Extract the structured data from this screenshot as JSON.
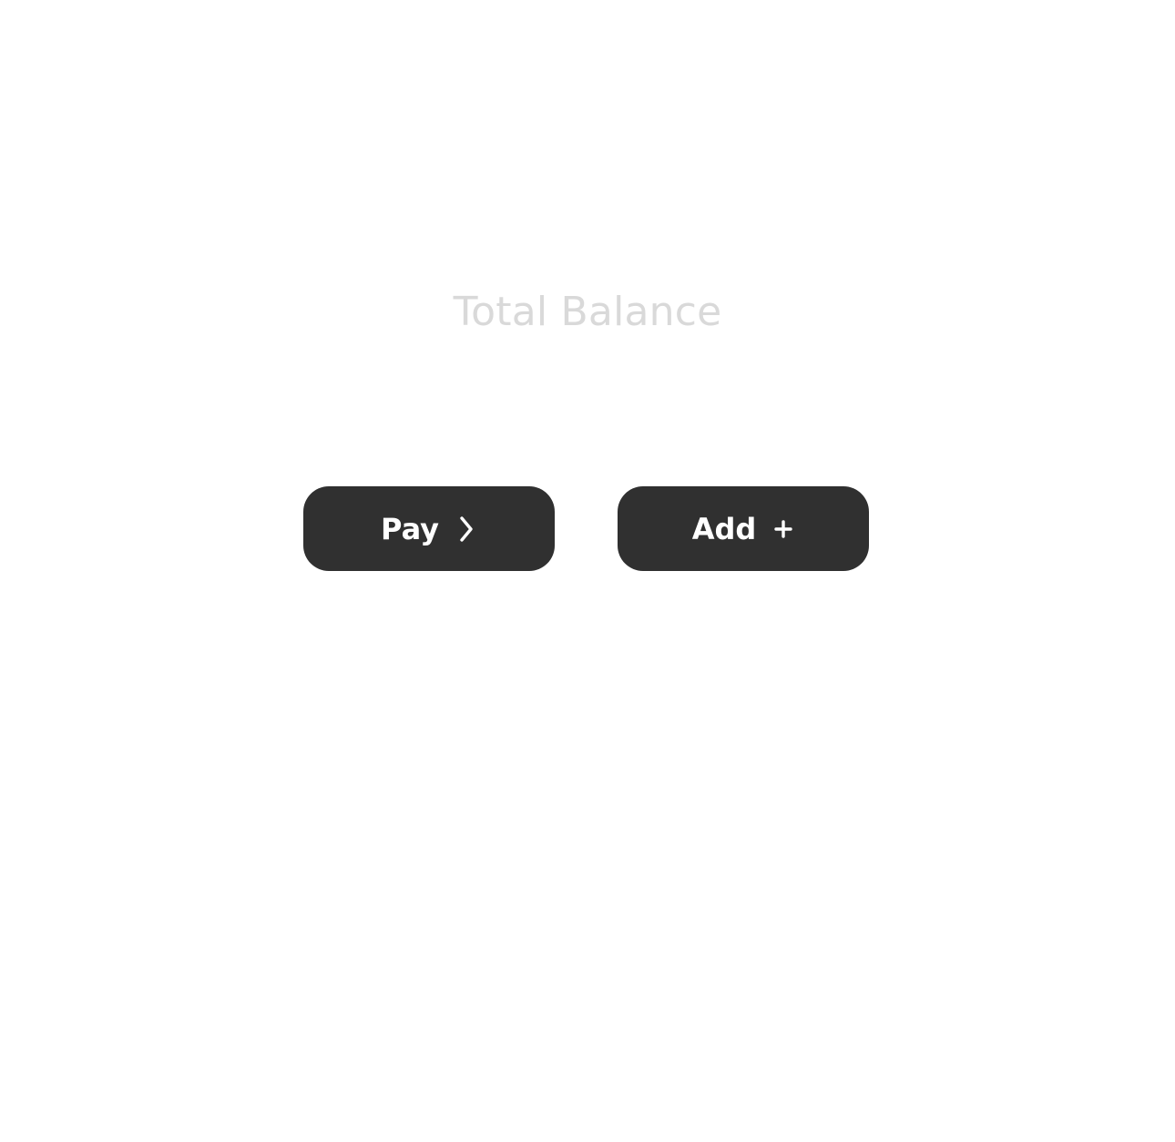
{
  "balance": {
    "label": "Total Balance"
  },
  "actions": {
    "pay": {
      "label": "Pay",
      "icon": "chevron-right-icon"
    },
    "add": {
      "label": "Add",
      "icon": "plus-icon"
    }
  },
  "colors": {
    "background": "#ffffff",
    "label_text": "#d9d9d9",
    "button_bg": "#303030",
    "button_text": "#ffffff"
  }
}
